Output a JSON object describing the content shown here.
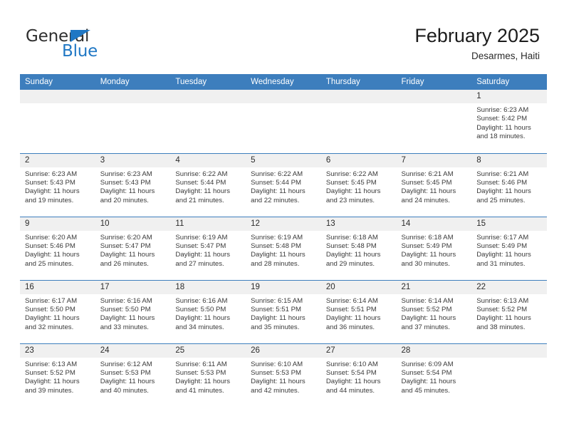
{
  "brand": {
    "name_part1": "General",
    "name_part2": "Blue",
    "triangle_color": "#1f77c4"
  },
  "header": {
    "title": "February 2025",
    "subtitle": "Desarmes, Haiti"
  },
  "theme": {
    "header_bar_color": "#3d7ebd",
    "daynum_bg": "#f0f0f0",
    "text_color": "#2b2b2b"
  },
  "weekday_headers": [
    "Sunday",
    "Monday",
    "Tuesday",
    "Wednesday",
    "Thursday",
    "Friday",
    "Saturday"
  ],
  "weeks": [
    [
      {
        "day": "",
        "empty": true
      },
      {
        "day": "",
        "empty": true
      },
      {
        "day": "",
        "empty": true
      },
      {
        "day": "",
        "empty": true
      },
      {
        "day": "",
        "empty": true
      },
      {
        "day": "",
        "empty": true
      },
      {
        "day": "1",
        "sunrise": "Sunrise: 6:23 AM",
        "sunset": "Sunset: 5:42 PM",
        "daylight": "Daylight: 11 hours and 18 minutes."
      }
    ],
    [
      {
        "day": "2",
        "sunrise": "Sunrise: 6:23 AM",
        "sunset": "Sunset: 5:43 PM",
        "daylight": "Daylight: 11 hours and 19 minutes."
      },
      {
        "day": "3",
        "sunrise": "Sunrise: 6:23 AM",
        "sunset": "Sunset: 5:43 PM",
        "daylight": "Daylight: 11 hours and 20 minutes."
      },
      {
        "day": "4",
        "sunrise": "Sunrise: 6:22 AM",
        "sunset": "Sunset: 5:44 PM",
        "daylight": "Daylight: 11 hours and 21 minutes."
      },
      {
        "day": "5",
        "sunrise": "Sunrise: 6:22 AM",
        "sunset": "Sunset: 5:44 PM",
        "daylight": "Daylight: 11 hours and 22 minutes."
      },
      {
        "day": "6",
        "sunrise": "Sunrise: 6:22 AM",
        "sunset": "Sunset: 5:45 PM",
        "daylight": "Daylight: 11 hours and 23 minutes."
      },
      {
        "day": "7",
        "sunrise": "Sunrise: 6:21 AM",
        "sunset": "Sunset: 5:45 PM",
        "daylight": "Daylight: 11 hours and 24 minutes."
      },
      {
        "day": "8",
        "sunrise": "Sunrise: 6:21 AM",
        "sunset": "Sunset: 5:46 PM",
        "daylight": "Daylight: 11 hours and 25 minutes."
      }
    ],
    [
      {
        "day": "9",
        "sunrise": "Sunrise: 6:20 AM",
        "sunset": "Sunset: 5:46 PM",
        "daylight": "Daylight: 11 hours and 25 minutes."
      },
      {
        "day": "10",
        "sunrise": "Sunrise: 6:20 AM",
        "sunset": "Sunset: 5:47 PM",
        "daylight": "Daylight: 11 hours and 26 minutes."
      },
      {
        "day": "11",
        "sunrise": "Sunrise: 6:19 AM",
        "sunset": "Sunset: 5:47 PM",
        "daylight": "Daylight: 11 hours and 27 minutes."
      },
      {
        "day": "12",
        "sunrise": "Sunrise: 6:19 AM",
        "sunset": "Sunset: 5:48 PM",
        "daylight": "Daylight: 11 hours and 28 minutes."
      },
      {
        "day": "13",
        "sunrise": "Sunrise: 6:18 AM",
        "sunset": "Sunset: 5:48 PM",
        "daylight": "Daylight: 11 hours and 29 minutes."
      },
      {
        "day": "14",
        "sunrise": "Sunrise: 6:18 AM",
        "sunset": "Sunset: 5:49 PM",
        "daylight": "Daylight: 11 hours and 30 minutes."
      },
      {
        "day": "15",
        "sunrise": "Sunrise: 6:17 AM",
        "sunset": "Sunset: 5:49 PM",
        "daylight": "Daylight: 11 hours and 31 minutes."
      }
    ],
    [
      {
        "day": "16",
        "sunrise": "Sunrise: 6:17 AM",
        "sunset": "Sunset: 5:50 PM",
        "daylight": "Daylight: 11 hours and 32 minutes."
      },
      {
        "day": "17",
        "sunrise": "Sunrise: 6:16 AM",
        "sunset": "Sunset: 5:50 PM",
        "daylight": "Daylight: 11 hours and 33 minutes."
      },
      {
        "day": "18",
        "sunrise": "Sunrise: 6:16 AM",
        "sunset": "Sunset: 5:50 PM",
        "daylight": "Daylight: 11 hours and 34 minutes."
      },
      {
        "day": "19",
        "sunrise": "Sunrise: 6:15 AM",
        "sunset": "Sunset: 5:51 PM",
        "daylight": "Daylight: 11 hours and 35 minutes."
      },
      {
        "day": "20",
        "sunrise": "Sunrise: 6:14 AM",
        "sunset": "Sunset: 5:51 PM",
        "daylight": "Daylight: 11 hours and 36 minutes."
      },
      {
        "day": "21",
        "sunrise": "Sunrise: 6:14 AM",
        "sunset": "Sunset: 5:52 PM",
        "daylight": "Daylight: 11 hours and 37 minutes."
      },
      {
        "day": "22",
        "sunrise": "Sunrise: 6:13 AM",
        "sunset": "Sunset: 5:52 PM",
        "daylight": "Daylight: 11 hours and 38 minutes."
      }
    ],
    [
      {
        "day": "23",
        "sunrise": "Sunrise: 6:13 AM",
        "sunset": "Sunset: 5:52 PM",
        "daylight": "Daylight: 11 hours and 39 minutes."
      },
      {
        "day": "24",
        "sunrise": "Sunrise: 6:12 AM",
        "sunset": "Sunset: 5:53 PM",
        "daylight": "Daylight: 11 hours and 40 minutes."
      },
      {
        "day": "25",
        "sunrise": "Sunrise: 6:11 AM",
        "sunset": "Sunset: 5:53 PM",
        "daylight": "Daylight: 11 hours and 41 minutes."
      },
      {
        "day": "26",
        "sunrise": "Sunrise: 6:10 AM",
        "sunset": "Sunset: 5:53 PM",
        "daylight": "Daylight: 11 hours and 42 minutes."
      },
      {
        "day": "27",
        "sunrise": "Sunrise: 6:10 AM",
        "sunset": "Sunset: 5:54 PM",
        "daylight": "Daylight: 11 hours and 44 minutes."
      },
      {
        "day": "28",
        "sunrise": "Sunrise: 6:09 AM",
        "sunset": "Sunset: 5:54 PM",
        "daylight": "Daylight: 11 hours and 45 minutes."
      },
      {
        "day": "",
        "empty": true
      }
    ]
  ]
}
